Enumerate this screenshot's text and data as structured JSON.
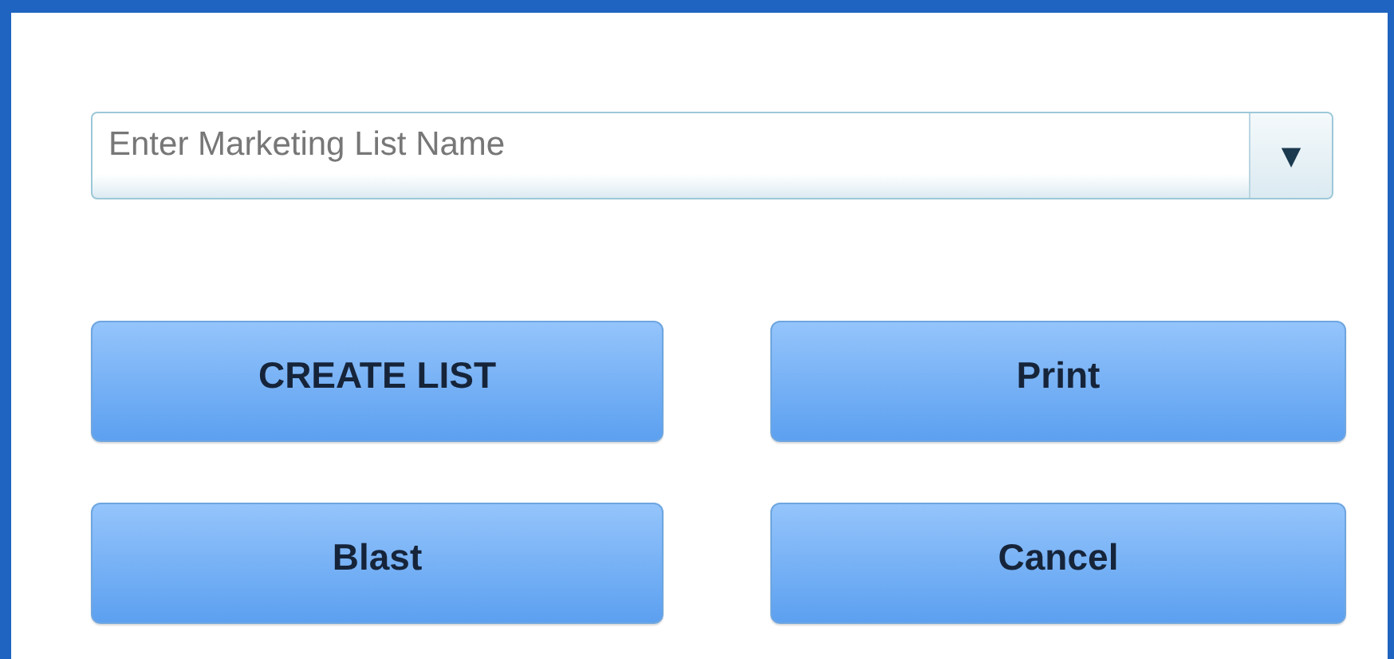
{
  "list_name_field": {
    "placeholder": "Enter Marketing List Name",
    "dropdown_symbol": "▼"
  },
  "buttons": [
    {
      "label": "CREATE LIST"
    },
    {
      "label": "Print"
    },
    {
      "label": "Blast"
    },
    {
      "label": "Cancel"
    }
  ]
}
